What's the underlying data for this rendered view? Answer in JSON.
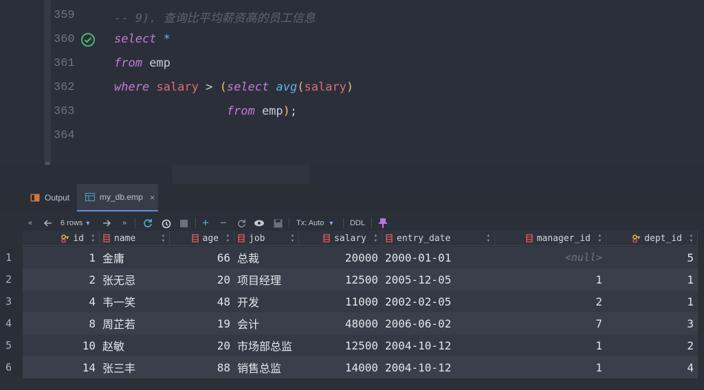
{
  "editor": {
    "lines": [
      {
        "no": "359",
        "tokens": [
          {
            "t": "-- 9). 查询比平均薪资高的员工信息",
            "c": "comment"
          }
        ]
      },
      {
        "no": "360",
        "check": true,
        "tokens": [
          {
            "t": "select",
            "c": "kw"
          },
          {
            "t": " ",
            "c": "plain"
          },
          {
            "t": "*",
            "c": "fn"
          }
        ]
      },
      {
        "no": "361",
        "tokens": [
          {
            "t": "from",
            "c": "kw"
          },
          {
            "t": " emp",
            "c": "plain"
          }
        ]
      },
      {
        "no": "362",
        "tokens": [
          {
            "t": "where",
            "c": "kw"
          },
          {
            "t": " ",
            "c": "plain"
          },
          {
            "t": "salary",
            "c": "id"
          },
          {
            "t": " > ",
            "c": "plain"
          },
          {
            "t": "(",
            "c": "paren"
          },
          {
            "t": "select",
            "c": "kw"
          },
          {
            "t": " ",
            "c": "plain"
          },
          {
            "t": "avg",
            "c": "fn"
          },
          {
            "t": "(",
            "c": "paren"
          },
          {
            "t": "salary",
            "c": "id"
          },
          {
            "t": ")",
            "c": "paren"
          }
        ]
      },
      {
        "no": "363",
        "tokens": [
          {
            "t": "                from",
            "c": "kw"
          },
          {
            "t": " emp",
            "c": "plain"
          },
          {
            "t": ")",
            "c": "paren"
          },
          {
            "t": ";",
            "c": "plain"
          }
        ]
      },
      {
        "no": "364",
        "tokens": []
      }
    ]
  },
  "tabs": [
    {
      "label": "Output",
      "icon": "output-icon",
      "active": false
    },
    {
      "label": "my_db.emp",
      "icon": "table-icon",
      "active": true,
      "close": "×"
    }
  ],
  "toolbar": {
    "rows_label": "6 rows",
    "tx_label": "Tx: Auto",
    "ddl_label": "DDL"
  },
  "grid": {
    "columns": [
      {
        "name": "id",
        "icon": "key-column-icon",
        "align": "r"
      },
      {
        "name": "name",
        "icon": "column-icon",
        "align": "l"
      },
      {
        "name": "age",
        "icon": "column-icon",
        "align": "r"
      },
      {
        "name": "job",
        "icon": "column-icon",
        "align": "l"
      },
      {
        "name": "salary",
        "icon": "column-icon",
        "align": "r"
      },
      {
        "name": "entry_date",
        "icon": "column-icon",
        "align": "l"
      },
      {
        "name": "manager_id",
        "icon": "column-icon",
        "align": "r"
      },
      {
        "name": "dept_id",
        "icon": "key-column-icon",
        "align": "r"
      }
    ],
    "rows": [
      {
        "n": "1",
        "cells": [
          "1",
          "金庸",
          "66",
          "总裁",
          "20000",
          "2000-01-01",
          "<null>",
          "5"
        ]
      },
      {
        "n": "2",
        "cells": [
          "2",
          "张无忌",
          "20",
          "项目经理",
          "12500",
          "2005-12-05",
          "1",
          "1"
        ]
      },
      {
        "n": "3",
        "cells": [
          "4",
          "韦一笑",
          "48",
          "开发",
          "11000",
          "2002-02-05",
          "2",
          "1"
        ]
      },
      {
        "n": "4",
        "cells": [
          "8",
          "周芷若",
          "19",
          "会计",
          "48000",
          "2006-06-02",
          "7",
          "3"
        ]
      },
      {
        "n": "5",
        "cells": [
          "10",
          "赵敏",
          "20",
          "市场部总监",
          "12500",
          "2004-10-12",
          "1",
          "2"
        ]
      },
      {
        "n": "6",
        "cells": [
          "14",
          "张三丰",
          "88",
          "销售总监",
          "14000",
          "2004-10-12",
          "1",
          "4"
        ]
      }
    ]
  },
  "colors": {
    "accent": "#5e8fd6",
    "check": "#4fb576",
    "pin": "#b678dd",
    "column_icon": "#d65a5a",
    "key_icon": "#e3b341"
  }
}
